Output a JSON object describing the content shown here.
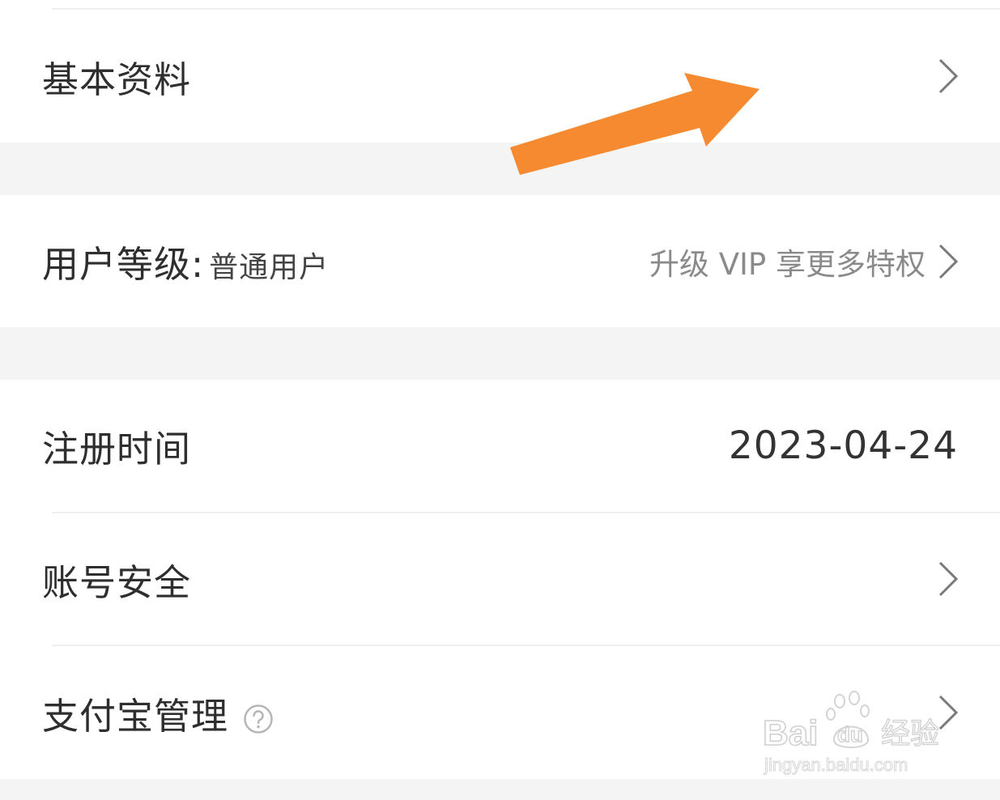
{
  "rows": {
    "basic_info": {
      "label": "基本资料"
    },
    "user_level": {
      "label": "用户等级:",
      "value": "普通用户",
      "upgrade": "升级 VIP 享更多特权"
    },
    "register_time": {
      "label": "注册时间",
      "value": "2023-04-24"
    },
    "account_security": {
      "label": "账号安全"
    },
    "alipay": {
      "label": "支付宝管理"
    }
  },
  "icons": {
    "chevron": "chevron-right-icon",
    "help": "question-circle-icon",
    "annotation": "orange-arrow"
  },
  "watermark": {
    "brand_left": "Bai",
    "brand_mid": "du",
    "brand_right": "经验",
    "url": "jingyan.baidu.com"
  },
  "colors": {
    "arrow": "#f58a31",
    "page_bg": "#f4f4f4",
    "row_bg": "#ffffff",
    "muted_text": "#8a8a8a"
  }
}
